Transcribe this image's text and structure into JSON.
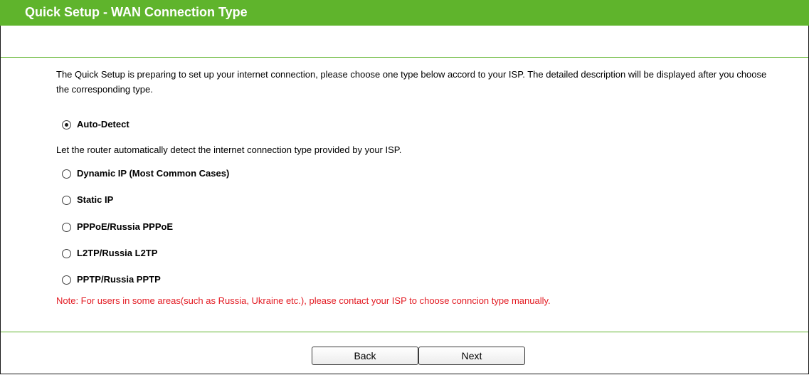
{
  "header": {
    "title": "Quick Setup - WAN Connection Type"
  },
  "intro": {
    "text": "The Quick Setup is preparing to set up your internet connection, please choose one type below accord to your ISP. The detailed description will be displayed after you choose the corresponding type."
  },
  "options": [
    {
      "label": "Auto-Detect",
      "checked": true
    },
    {
      "label": "Dynamic IP (Most Common Cases)",
      "checked": false
    },
    {
      "label": "Static IP",
      "checked": false
    },
    {
      "label": "PPPoE/Russia PPPoE",
      "checked": false
    },
    {
      "label": "L2TP/Russia L2TP",
      "checked": false
    },
    {
      "label": "PPTP/Russia PPTP",
      "checked": false
    }
  ],
  "auto_detect_description": "Let the router automatically detect the internet connection type provided by your ISP.",
  "note": "Note: For users in some areas(such as Russia, Ukraine etc.), please contact your ISP to choose conncion type manually.",
  "buttons": {
    "back_label": "Back",
    "next_label": "Next"
  },
  "colors": {
    "header_bg": "#5fb42c",
    "header_text": "#ffffff",
    "note_text": "#e31b23",
    "divider": "#5fb42c"
  }
}
